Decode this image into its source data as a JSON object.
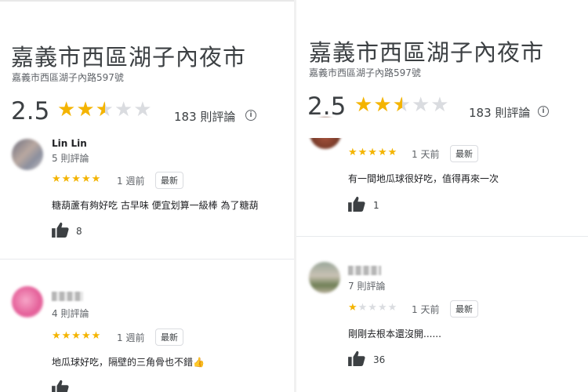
{
  "place": {
    "name": "嘉義市西區湖子內夜市",
    "address": "嘉義市西區湖子內路597號",
    "rating": "2.5",
    "rating_value": 2.5,
    "review_count": "183 則評論"
  },
  "left_reviews": [
    {
      "name": "Lin Lin",
      "meta": "5 則評論",
      "stars": 5,
      "time": "1 週前",
      "badge": "最新",
      "text": "糖葫蘆有夠好吃 古早味 便宜划算一級棒 為了糖葫",
      "likes": "8"
    },
    {
      "name": "",
      "meta": "4 則評論",
      "stars": 5,
      "time": "1 週前",
      "badge": "最新",
      "text": "地瓜球好吃，隔壁的三角骨也不錯👍",
      "likes": ""
    }
  ],
  "right_reviews": [
    {
      "meta": "",
      "stars": 5,
      "time": "1 天前",
      "badge": "最新",
      "text": "有一間地瓜球很好吃，值得再來一次",
      "likes": "1"
    },
    {
      "meta": "7 則評論",
      "stars": 1,
      "time": "1 天前",
      "badge": "最新",
      "text": "剛剛去根本還沒開......",
      "likes": "36"
    }
  ],
  "colors": {
    "star": "#f4b400",
    "star_empty": "#dadce0",
    "text": "#202124",
    "muted": "#5f6368"
  },
  "icons": {
    "info": "info-icon",
    "like": "thumbs-up-icon"
  }
}
